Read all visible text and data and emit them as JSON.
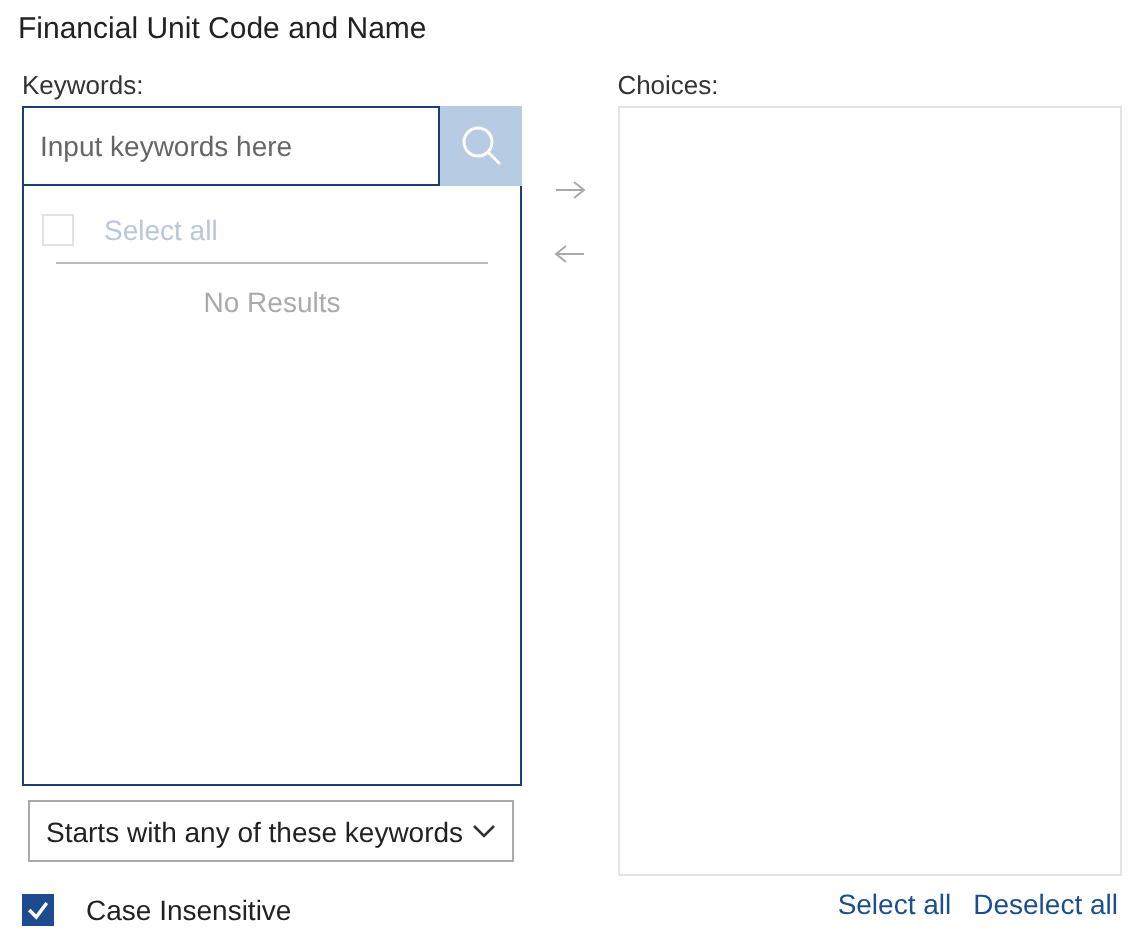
{
  "title": "Financial Unit Code and Name",
  "keywords": {
    "label": "Keywords:",
    "placeholder": "Input keywords here",
    "select_all": {
      "label": "Select all",
      "checked": false,
      "disabled": true
    },
    "empty_text": "No Results"
  },
  "match_mode": {
    "value": "Starts with any of these keywords"
  },
  "case_insensitive": {
    "label": "Case Insensitive",
    "checked": true
  },
  "transfer": {
    "add_disabled": true,
    "remove_disabled": true
  },
  "choices": {
    "label": "Choices:",
    "links": [
      "Select all",
      "Deselect all"
    ]
  }
}
